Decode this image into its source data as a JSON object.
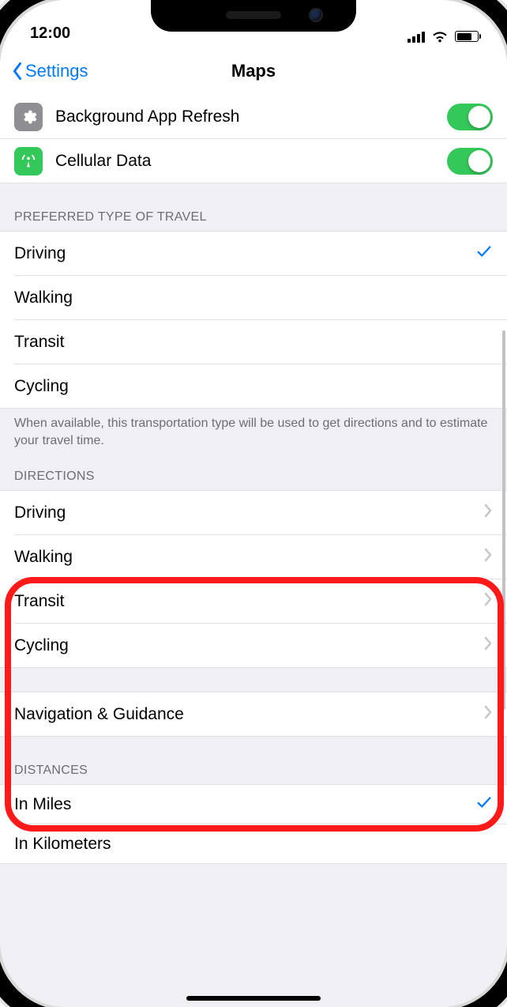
{
  "status": {
    "time": "12:00"
  },
  "nav": {
    "back": "Settings",
    "title": "Maps"
  },
  "top_toggles": [
    {
      "label": "Background App Refresh",
      "icon": "gear",
      "on": true
    },
    {
      "label": "Cellular Data",
      "icon": "cellular",
      "on": true
    }
  ],
  "preferred": {
    "header": "PREFERRED TYPE OF TRAVEL",
    "items": [
      {
        "label": "Driving",
        "selected": true
      },
      {
        "label": "Walking",
        "selected": false
      },
      {
        "label": "Transit",
        "selected": false
      },
      {
        "label": "Cycling",
        "selected": false
      }
    ],
    "footer": "When available, this transportation type will be used to get directions and to estimate your travel time."
  },
  "directions": {
    "header": "DIRECTIONS",
    "items": [
      {
        "label": "Driving"
      },
      {
        "label": "Walking"
      },
      {
        "label": "Transit"
      },
      {
        "label": "Cycling"
      }
    ]
  },
  "nav_guidance": {
    "label": "Navigation & Guidance"
  },
  "distances": {
    "header": "DISTANCES",
    "items": [
      {
        "label": "In Miles",
        "selected": true
      },
      {
        "label": "In Kilometers",
        "selected": false
      }
    ]
  }
}
